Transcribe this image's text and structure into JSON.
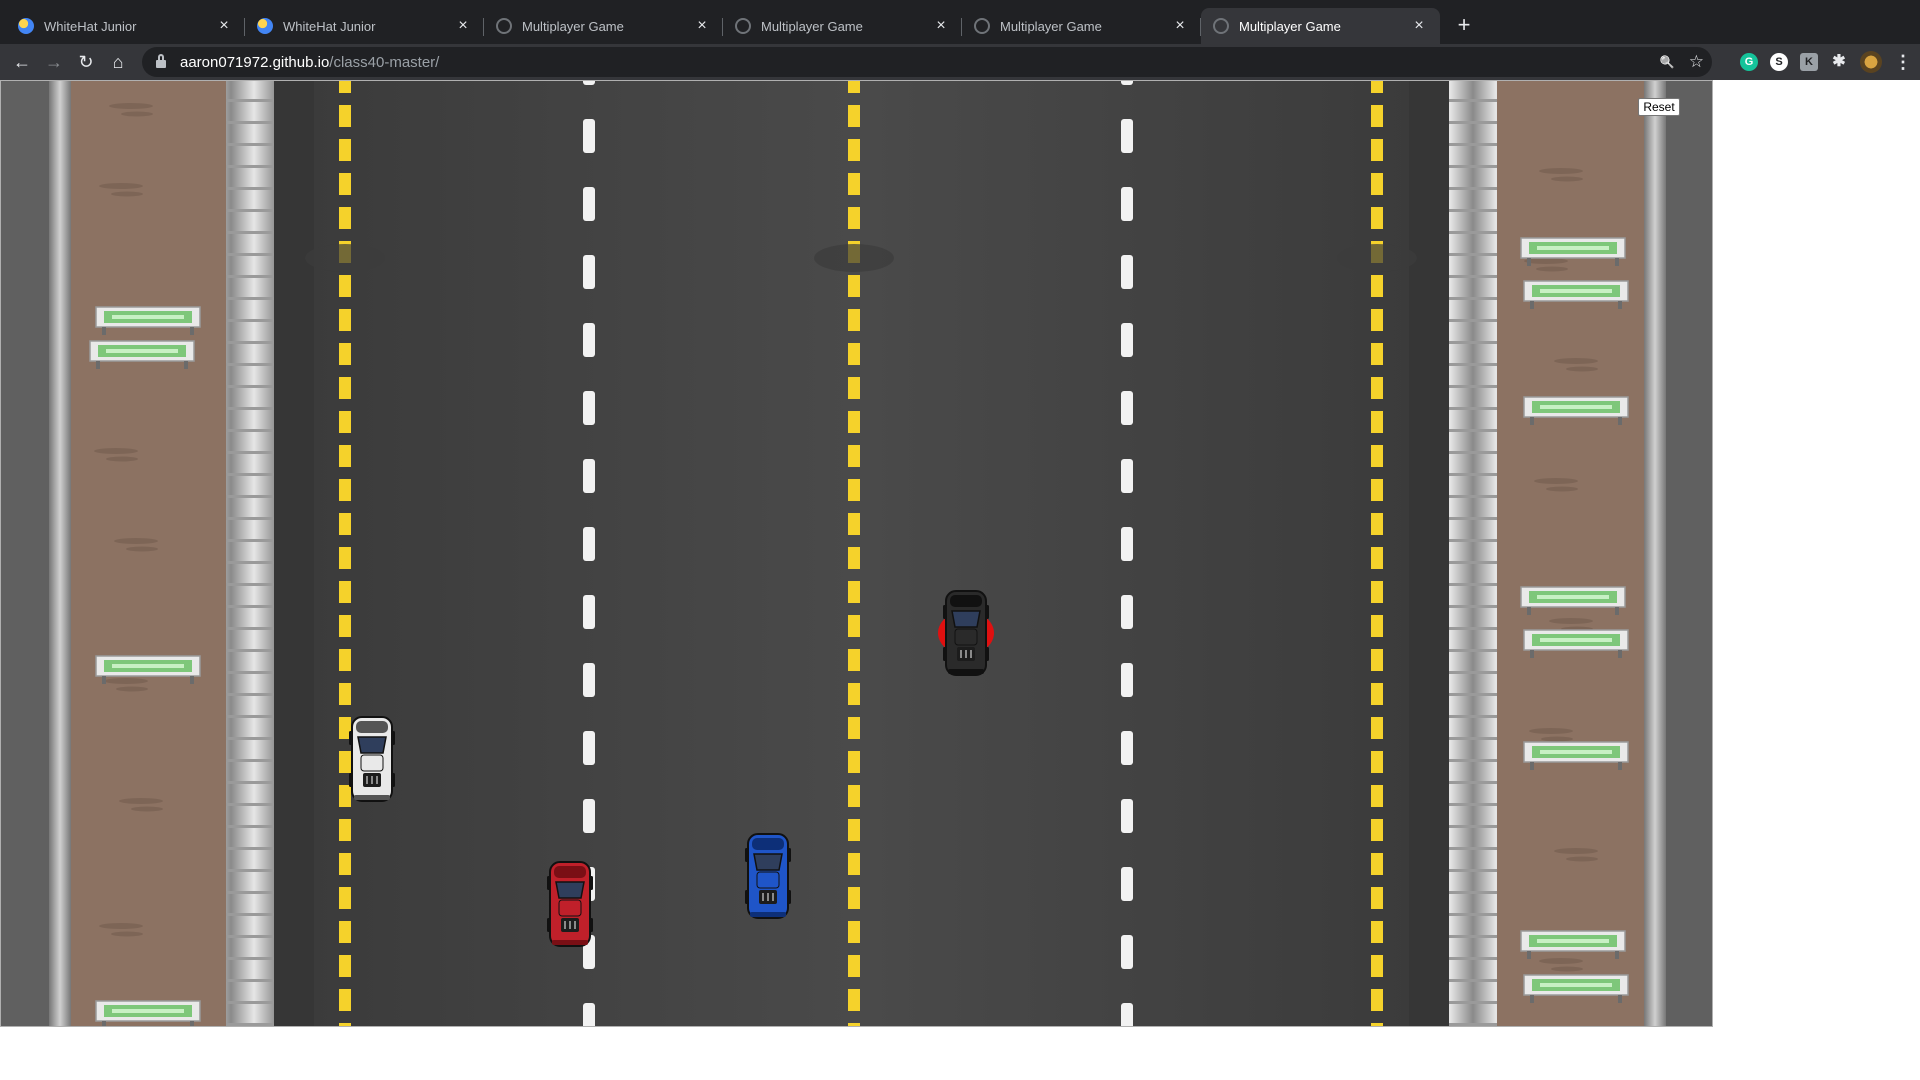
{
  "browser": {
    "tabs": [
      {
        "title": "WhiteHat Junior",
        "icon": "whitehat-icon",
        "active": false
      },
      {
        "title": "WhiteHat Junior",
        "icon": "whitehat-icon",
        "active": false
      },
      {
        "title": "Multiplayer Game",
        "icon": "globe-icon",
        "active": false
      },
      {
        "title": "Multiplayer Game",
        "icon": "globe-icon",
        "active": false
      },
      {
        "title": "Multiplayer Game",
        "icon": "globe-icon",
        "active": false
      },
      {
        "title": "Multiplayer Game",
        "icon": "globe-icon",
        "active": true
      }
    ],
    "tab_close_glyph": "×",
    "new_tab_glyph": "+",
    "nav": {
      "back": "←",
      "forward": "→",
      "reload": "↻",
      "home": "⌂"
    },
    "url": {
      "host": "aaron071972.github.io",
      "path": "/class40-master/"
    },
    "omnibox_icons": {
      "zoom": "🔍",
      "star": "☆"
    },
    "extensions": [
      {
        "name": "grammarly-icon",
        "letter": "G",
        "color": "#15c39a"
      },
      {
        "name": "s-extension-icon",
        "letter": "S",
        "color": "#ffffff"
      },
      {
        "name": "k-extension-icon",
        "letter": "K",
        "color": "#9aa0a6"
      }
    ],
    "menu_glyph": "⋮",
    "puzzle_glyph": "✱"
  },
  "game": {
    "reset_label": "Reset",
    "cars": [
      {
        "name": "white-car",
        "body": "#e9e9e9",
        "trim": "#555555"
      },
      {
        "name": "red-car",
        "body": "#c0202a",
        "trim": "#7a0f15"
      },
      {
        "name": "blue-car",
        "body": "#1f55c8",
        "trim": "#0d2f78"
      },
      {
        "name": "black-car-highlighted",
        "body": "#2a2a2a",
        "trim": "#111111",
        "highlight": "#e01010"
      }
    ],
    "colors": {
      "road": "#474747",
      "shoulder": "#8c7262",
      "lane_yellow": "#f5d22b",
      "lane_white": "#f2f2f2",
      "barrier": "#d8d8d8",
      "bench_green": "#7ec77a"
    }
  }
}
